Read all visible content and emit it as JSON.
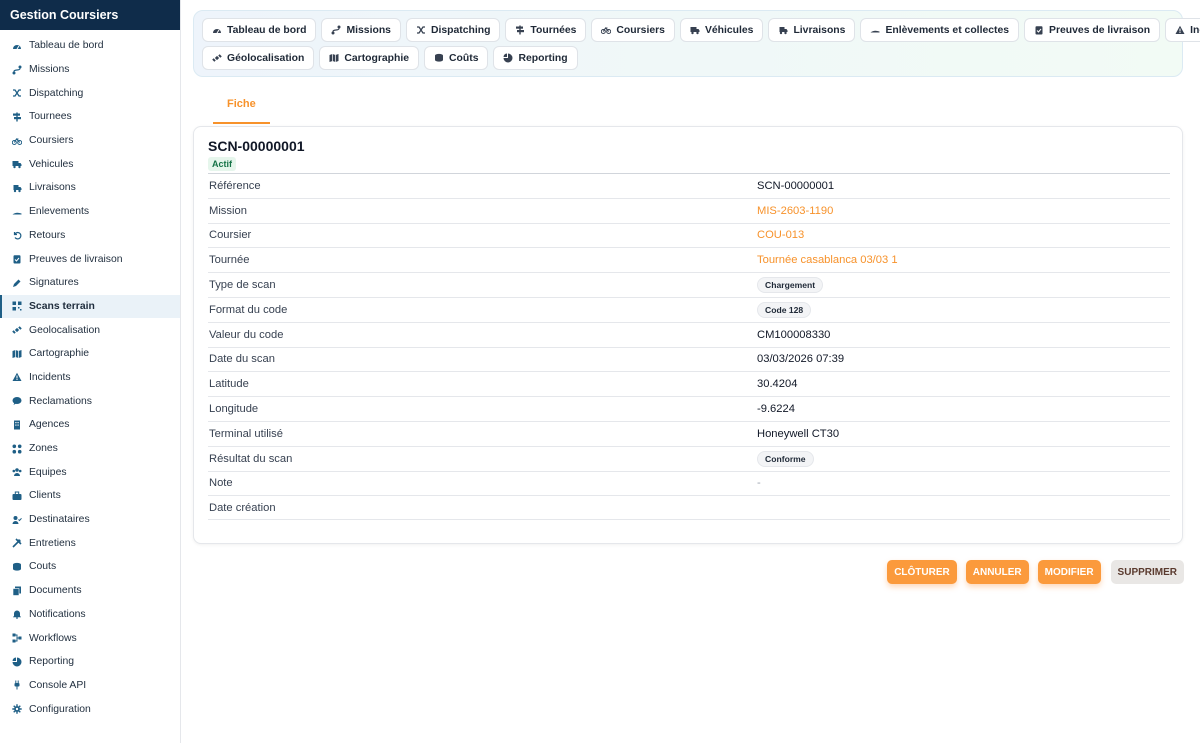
{
  "app": {
    "title": "Gestion Coursiers"
  },
  "sidebar": {
    "items": [
      {
        "label": "Tableau de bord",
        "icon": "dashboard-icon"
      },
      {
        "label": "Missions",
        "icon": "route-icon"
      },
      {
        "label": "Dispatching",
        "icon": "shuffle-icon"
      },
      {
        "label": "Tournees",
        "icon": "signpost-icon"
      },
      {
        "label": "Coursiers",
        "icon": "bicycle-icon"
      },
      {
        "label": "Vehicules",
        "icon": "truck-icon"
      },
      {
        "label": "Livraisons",
        "icon": "truck-fast-icon"
      },
      {
        "label": "Enlevements",
        "icon": "dolly-icon"
      },
      {
        "label": "Retours",
        "icon": "undo-icon"
      },
      {
        "label": "Preuves de livraison",
        "icon": "clipboard-check-icon"
      },
      {
        "label": "Signatures",
        "icon": "signature-icon"
      },
      {
        "label": "Scans terrain",
        "icon": "qrcode-icon",
        "active": true
      },
      {
        "label": "Geolocalisation",
        "icon": "satellite-icon"
      },
      {
        "label": "Cartographie",
        "icon": "map-icon"
      },
      {
        "label": "Incidents",
        "icon": "warning-icon"
      },
      {
        "label": "Reclamations",
        "icon": "comment-icon"
      },
      {
        "label": "Agences",
        "icon": "building-icon"
      },
      {
        "label": "Zones",
        "icon": "zones-icon"
      },
      {
        "label": "Equipes",
        "icon": "users-icon"
      },
      {
        "label": "Clients",
        "icon": "briefcase-icon"
      },
      {
        "label": "Destinataires",
        "icon": "user-check-icon"
      },
      {
        "label": "Entretiens",
        "icon": "tools-icon"
      },
      {
        "label": "Couts",
        "icon": "coins-icon"
      },
      {
        "label": "Documents",
        "icon": "documents-icon"
      },
      {
        "label": "Notifications",
        "icon": "bell-icon"
      },
      {
        "label": "Workflows",
        "icon": "workflow-icon"
      },
      {
        "label": "Reporting",
        "icon": "pie-chart-icon"
      },
      {
        "label": "Console API",
        "icon": "plug-icon"
      },
      {
        "label": "Configuration",
        "icon": "gear-icon"
      }
    ]
  },
  "quick_nav": {
    "row1": [
      {
        "label": "Tableau de bord",
        "icon": "dashboard-icon"
      },
      {
        "label": "Missions",
        "icon": "route-icon"
      },
      {
        "label": "Dispatching",
        "icon": "shuffle-icon"
      },
      {
        "label": "Tournées",
        "icon": "signpost-icon"
      },
      {
        "label": "Coursiers",
        "icon": "bicycle-icon"
      },
      {
        "label": "Véhicules",
        "icon": "truck-icon"
      },
      {
        "label": "Livraisons",
        "icon": "truck-fast-icon"
      },
      {
        "label": "Enlèvements et collectes",
        "icon": "dolly-icon"
      },
      {
        "label": "Preuves de livraison",
        "icon": "clipboard-check-icon"
      },
      {
        "label": "Incidents",
        "icon": "warning-icon"
      }
    ],
    "row2": [
      {
        "label": "Géolocalisation",
        "icon": "satellite-icon"
      },
      {
        "label": "Cartographie",
        "icon": "map-icon"
      },
      {
        "label": "Coûts",
        "icon": "coins-icon"
      },
      {
        "label": "Reporting",
        "icon": "pie-chart-icon"
      }
    ]
  },
  "tabs": [
    {
      "label": "Fiche",
      "active": true
    }
  ],
  "record": {
    "title": "SCN-00000001",
    "status": "Actif",
    "fields": [
      {
        "label": "Référence",
        "value": "SCN-00000001",
        "kind": "text"
      },
      {
        "label": "Mission",
        "value": "MIS-2603-1190",
        "kind": "link"
      },
      {
        "label": "Coursier",
        "value": "COU-013",
        "kind": "link"
      },
      {
        "label": "Tournée",
        "value": "Tournée casablanca 03/03 1",
        "kind": "link"
      },
      {
        "label": "Type de scan",
        "value": "Chargement",
        "kind": "chip"
      },
      {
        "label": "Format du code",
        "value": "Code 128",
        "kind": "chip"
      },
      {
        "label": "Valeur du code",
        "value": "CM100008330",
        "kind": "text"
      },
      {
        "label": "Date du scan",
        "value": "03/03/2026 07:39",
        "kind": "text"
      },
      {
        "label": "Latitude",
        "value": "30.4204",
        "kind": "text"
      },
      {
        "label": "Longitude",
        "value": "-9.6224",
        "kind": "text"
      },
      {
        "label": "Terminal utilisé",
        "value": "Honeywell CT30",
        "kind": "text"
      },
      {
        "label": "Résultat du scan",
        "value": "Conforme",
        "kind": "chip"
      },
      {
        "label": "Note",
        "value": "-",
        "kind": "muted"
      },
      {
        "label": "Date création",
        "value": "",
        "kind": "text"
      }
    ]
  },
  "actions": {
    "close_label": "CLÔTURER",
    "cancel_label": "ANNULER",
    "edit_label": "MODIFIER",
    "delete_label": "SUPPRIMER"
  },
  "colors": {
    "sidebar_header": "#0f2c4a",
    "accent": "#f7922b",
    "active_bg": "#eaf2f8"
  }
}
